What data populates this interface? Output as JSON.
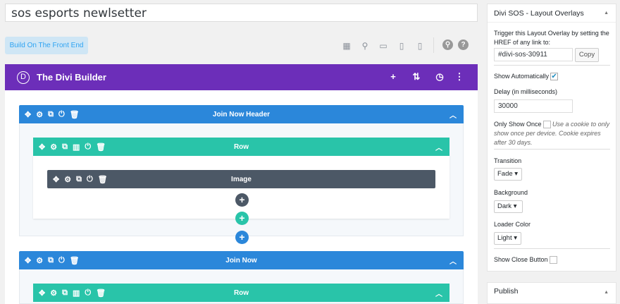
{
  "title": "sos esports newlsetter",
  "front_end_button": "Build On The Front End",
  "toolbar": {
    "icons": [
      "wireframe-icon",
      "zoom-icon",
      "desktop-icon",
      "tablet-icon",
      "phone-icon",
      "search-icon",
      "help-icon"
    ],
    "help": "?"
  },
  "builder": {
    "logo": "D",
    "title": "The Divi Builder"
  },
  "sections": [
    {
      "label": "Join Now Header",
      "row": "Row",
      "module": "Image"
    },
    {
      "label": "Join Now",
      "row": "Row"
    }
  ],
  "panel": {
    "title": "Divi SOS - Layout Overlays",
    "trigger_text": "Trigger this Layout Overlay by setting the HREF of any link to:",
    "href_value": "#divi-sos-30911",
    "copy": "Copy",
    "show_auto": "Show Automatically",
    "show_auto_checked": true,
    "delay_label": "Delay (in milliseconds)",
    "delay_value": "30000",
    "only_once": "Only Show Once",
    "only_once_note": "Use a cookie to only show once per device. Cookie expires after 30 days.",
    "transition_label": "Transition",
    "transition": "Fade",
    "background_label": "Background",
    "background": "Dark",
    "loader_label": "Loader Color",
    "loader": "Light",
    "close_label": "Show Close Button"
  },
  "publish": "Publish",
  "colors": {
    "purple": "#6c2eb9",
    "section": "#2b87da",
    "row": "#29c4a9",
    "module": "#4c5866"
  }
}
